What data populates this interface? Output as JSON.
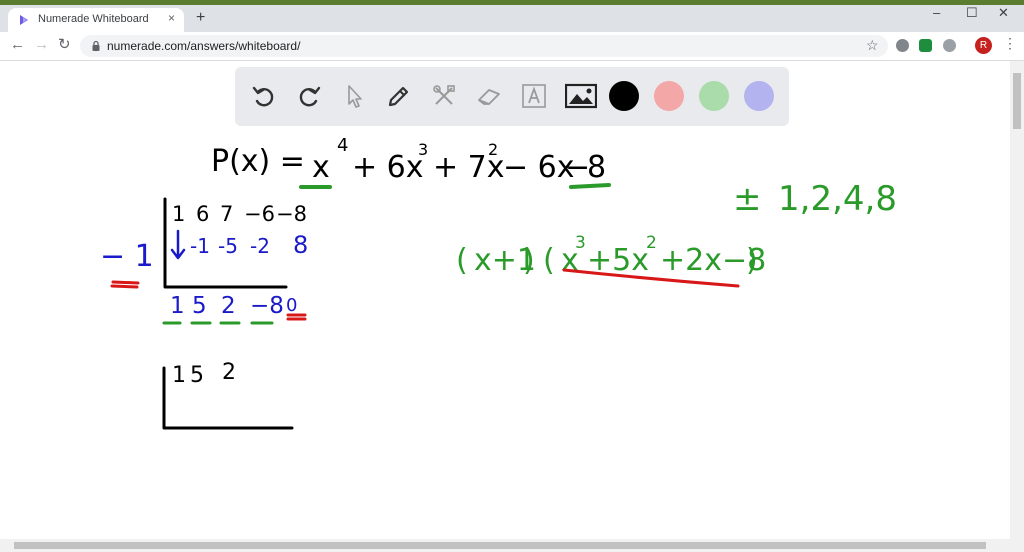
{
  "browser": {
    "tab_title": "Numerade Whiteboard",
    "tab_close": "×",
    "new_tab": "+",
    "url": "numerade.com/answers/whiteboard/",
    "avatar_initial": "R",
    "window_controls": {
      "minimize": "–",
      "maximize": "☐",
      "close": "✕"
    }
  },
  "toolbar": {
    "tools": [
      "undo-icon",
      "redo-icon",
      "select-pointer-icon",
      "pen-icon",
      "tools-icon",
      "eraser-icon",
      "text-icon",
      "image-icon"
    ],
    "colors": [
      "#000000",
      "#f4a7a7",
      "#a9dbab",
      "#b3b3ef"
    ]
  },
  "whiteboard": {
    "polynomial": {
      "lhs": "P(x) =",
      "t1": "x",
      "t1_exp": "4",
      "t2": "+ 6x",
      "t2_exp": "3",
      "t3": "+ 7x",
      "t3_exp": "2",
      "t4": "− 6x",
      "t5": "−",
      "t5_val": "8"
    },
    "rational_roots": {
      "pm": "±",
      "values": "1,2,4,8"
    },
    "factored": {
      "open1": "(",
      "inner1": "x+1",
      "close1": ")",
      "open2": "(",
      "x": "x",
      "e3": "3",
      "p1": "+5x",
      "e2": "2",
      "p2": "+2x−8",
      "close2": ")"
    },
    "division1": {
      "root": "− 1",
      "coefficients": [
        "1",
        "6",
        "7",
        "−6",
        "−8"
      ],
      "products": [
        "-1",
        "-5",
        "-2",
        "8"
      ],
      "results": [
        "1",
        "5",
        "2",
        "−8",
        "0"
      ]
    },
    "division2": {
      "coefficients": [
        "1",
        "5",
        "2"
      ]
    }
  },
  "colors": {
    "black": "#000000",
    "blue": "#1a1ac8",
    "green": "#2a9a2a",
    "red": "#d81818"
  }
}
